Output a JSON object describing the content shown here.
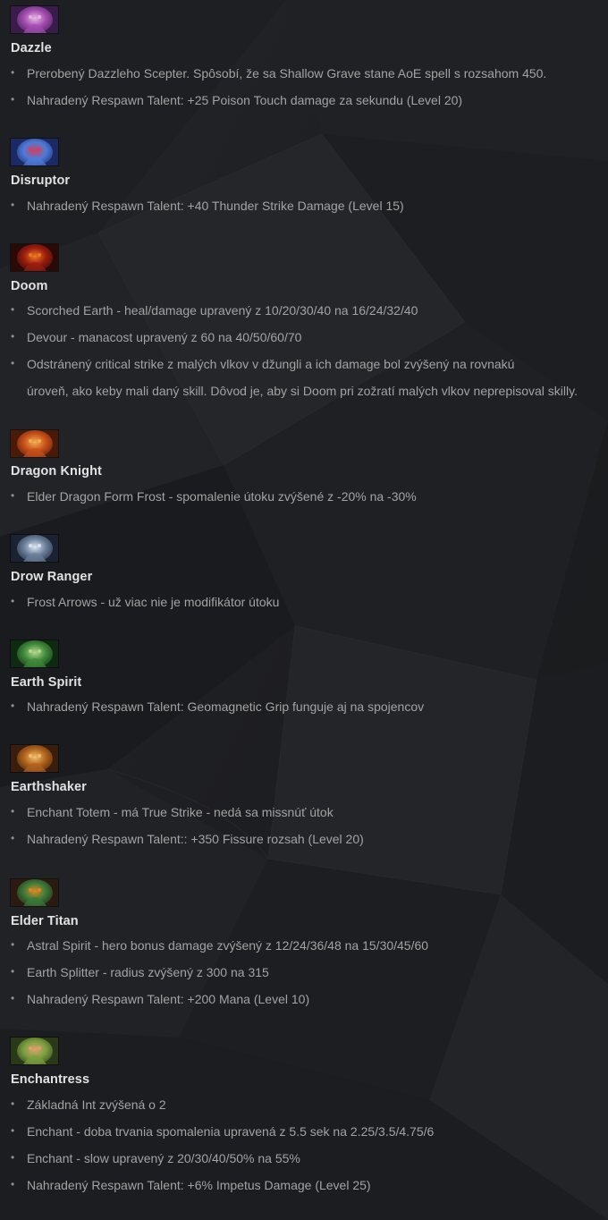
{
  "heroes": [
    {
      "name": "Dazzle",
      "portrait_icon": "dazzle-portrait",
      "portrait_colors": [
        "#3a1c4a",
        "#a24bb0",
        "#e7b8e0"
      ],
      "items": [
        "Prerobený Dazzleho Scepter. Spôsobí, že sa Shallow Grave stane AoE spell s rozsahom 450.",
        "Nahradený Respawn Talent: +25 Poison Touch damage za sekundu (Level 20)"
      ]
    },
    {
      "name": "Disruptor",
      "portrait_icon": "disruptor-portrait",
      "portrait_colors": [
        "#1b2a66",
        "#4f7bd8",
        "#d04060"
      ],
      "items": [
        "Nahradený Respawn Talent: +40 Thunder Strike Damage (Level 15)"
      ]
    },
    {
      "name": "Doom",
      "portrait_icon": "doom-portrait",
      "portrait_colors": [
        "#2a0a06",
        "#9a1c10",
        "#f07a20"
      ],
      "items": [
        "Scorched Earth - heal/damage upravený z 10/20/30/40 na 16/24/32/40",
        "Devour - manacost upravený z 60 na 40/50/60/70",
        "Odstránený critical strike z malých vlkov v džungli a ich damage bol zvýšený na rovnakú úroveň, ako keby mali daný skill. Dôvod je, aby si Doom pri zožratí malých vlkov neprepisoval skilly."
      ]
    },
    {
      "name": "Dragon Knight",
      "portrait_icon": "dragon-knight-portrait",
      "portrait_colors": [
        "#4a1a08",
        "#c8501a",
        "#f0b050"
      ],
      "items": [
        "Elder Dragon Form Frost - spomalenie útoku zvýšené z -20% na -30%"
      ]
    },
    {
      "name": "Drow Ranger",
      "portrait_icon": "drow-ranger-portrait",
      "portrait_colors": [
        "#1a2233",
        "#6a7f9a",
        "#dfe6f0"
      ],
      "items": [
        "Frost Arrows - už viac nie je modifikátor útoku"
      ]
    },
    {
      "name": "Earth Spirit",
      "portrait_icon": "earth-spirit-portrait",
      "portrait_colors": [
        "#0f2a12",
        "#3f8a3a",
        "#b8d890"
      ],
      "items": [
        "Nahradený Respawn Talent: Geomagnetic Grip funguje aj na spojencov"
      ]
    },
    {
      "name": "Earthshaker",
      "portrait_icon": "earthshaker-portrait",
      "portrait_colors": [
        "#3a1e0c",
        "#b0621c",
        "#f0c070"
      ],
      "items": [
        "Enchant Totem - má True Strike - nedá sa missnúť útok",
        "Nahradený Respawn Talent:: +350 Fissure rozsah (Level 20)"
      ]
    },
    {
      "name": "Elder Titan",
      "portrait_icon": "elder-titan-portrait",
      "portrait_colors": [
        "#2a1a10",
        "#3a7a3a",
        "#e08a20"
      ],
      "items": [
        "Astral Spirit - hero bonus damage zvýšený z 12/24/36/48 na 15/30/45/60",
        "Earth Splitter - radius zvýšený z 300 na 315",
        "Nahradený Respawn Talent: +200 Mana (Level 10)"
      ]
    },
    {
      "name": "Enchantress",
      "portrait_icon": "enchantress-portrait",
      "portrait_colors": [
        "#2a3a18",
        "#7aa040",
        "#e0a070"
      ],
      "items": [
        "Základná Int zvýšená o 2",
        "Enchant - doba trvania spomalenia upravená z 5.5 sek na 2.25/3.5/4.75/6",
        "Enchant - slow upravený z 20/30/40/50% na 55%",
        "Nahradený Respawn Talent: +6% Impetus Damage (Level 25)"
      ]
    }
  ],
  "doom_wrap": {
    "line1": "Odstránený critical strike z malých vlkov v džungli a ich damage bol zvýšený na rovnakú",
    "line2": "úroveň, ako keby mali daný skill. Dôvod je, aby si Doom pri zožratí malých vlkov neprepisoval skilly."
  },
  "colors": {
    "background": "#1b1c1f",
    "hero_name": "#e2e2e2",
    "item_text": "#a3a3a3"
  }
}
